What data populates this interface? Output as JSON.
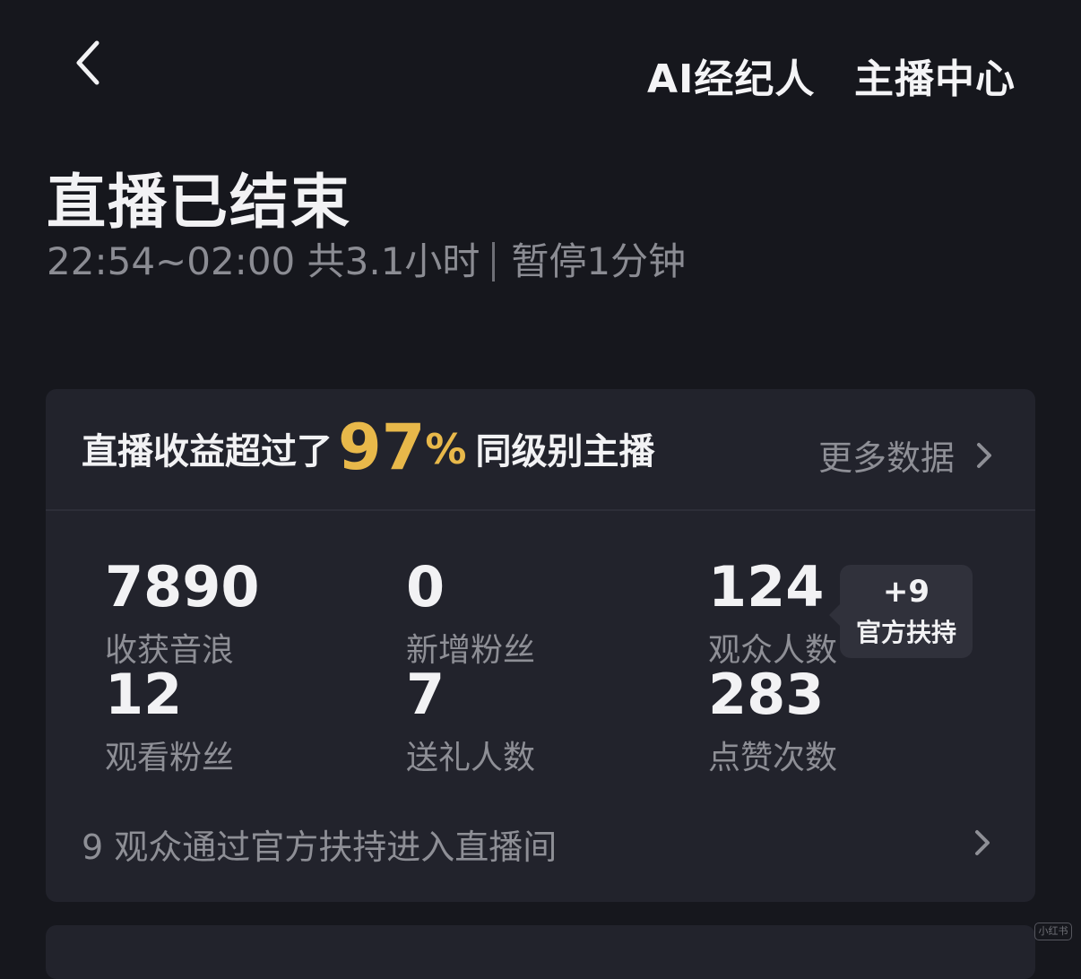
{
  "topbar": {
    "ai_agent_label": "AI经纪人",
    "host_center_label": "主播中心"
  },
  "header": {
    "title": "直播已结束",
    "time_range": "22:54~02:00",
    "duration": "共3.1小时",
    "pause": "暂停1分钟"
  },
  "summary": {
    "prefix": "直播收益超过了",
    "percent": "97",
    "percent_sign": "%",
    "suffix": "同级别主播",
    "more_label": "更多数据",
    "accent_color": "#e8b84a"
  },
  "stats": [
    {
      "value": "7890",
      "label": "收获音浪"
    },
    {
      "value": "0",
      "label": "新增粉丝"
    },
    {
      "value": "124",
      "label": "观众人数"
    },
    {
      "value": "12",
      "label": "观看粉丝"
    },
    {
      "value": "7",
      "label": "送礼人数"
    },
    {
      "value": "283",
      "label": "点赞次数"
    }
  ],
  "support_badge": {
    "plus": "+9",
    "label": "官方扶持"
  },
  "footer": {
    "text": "9 观众通过官方扶持进入直播间"
  },
  "watermark": "小红书"
}
